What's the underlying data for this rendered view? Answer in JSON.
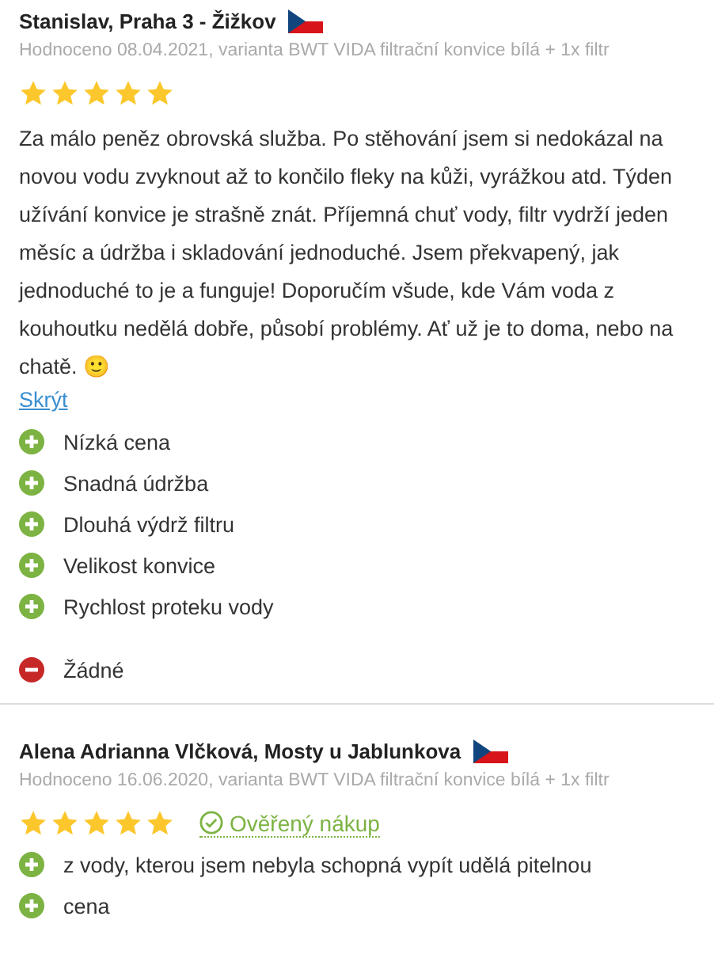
{
  "reviews": [
    {
      "author": "Stanislav, Praha 3 - Žižkov",
      "meta": "Hodnoceno 08.04.2021, varianta BWT VIDA filtrační konvice bílá + 1x filtr",
      "stars": 5,
      "verified": false,
      "body": "Za málo peněz obrovská služba. Po stěhování jsem si nedokázal na novou vodu zvyknout až to končilo fleky na kůži, vyrážkou atd. Týden užívání konvice je strašně znát. Příjemná chuť vody, filtr vydrží jeden měsíc a údržba i skladování jednoduché. Jsem překvapený, jak jednoduché to je a funguje! Doporučím všude, kde Vám voda z kouhoutku nedělá dobře, působí problémy. Ať už je to doma, nebo na chatě. 🙂",
      "hide_link": "Skrýt",
      "points": [
        {
          "kind": "pro",
          "text": "Nízká cena"
        },
        {
          "kind": "pro",
          "text": "Snadná údržba"
        },
        {
          "kind": "pro",
          "text": "Dlouhá výdrž filtru"
        },
        {
          "kind": "pro",
          "text": "Velikost konvice"
        },
        {
          "kind": "pro",
          "text": "Rychlost proteku vody"
        },
        {
          "kind": "con",
          "text": "Žádné"
        }
      ]
    },
    {
      "author": "Alena Adrianna Vlčková, Mosty u Jablunkova",
      "meta": "Hodnoceno 16.06.2020, varianta BWT VIDA filtrační konvice bílá + 1x filtr",
      "stars": 5,
      "verified": true,
      "verified_label": "Ověřený nákup",
      "points": [
        {
          "kind": "pro",
          "text": "z vody, kterou jsem nebyla schopná vypít udělá pitelnou"
        },
        {
          "kind": "pro",
          "text": "cena"
        }
      ]
    }
  ]
}
